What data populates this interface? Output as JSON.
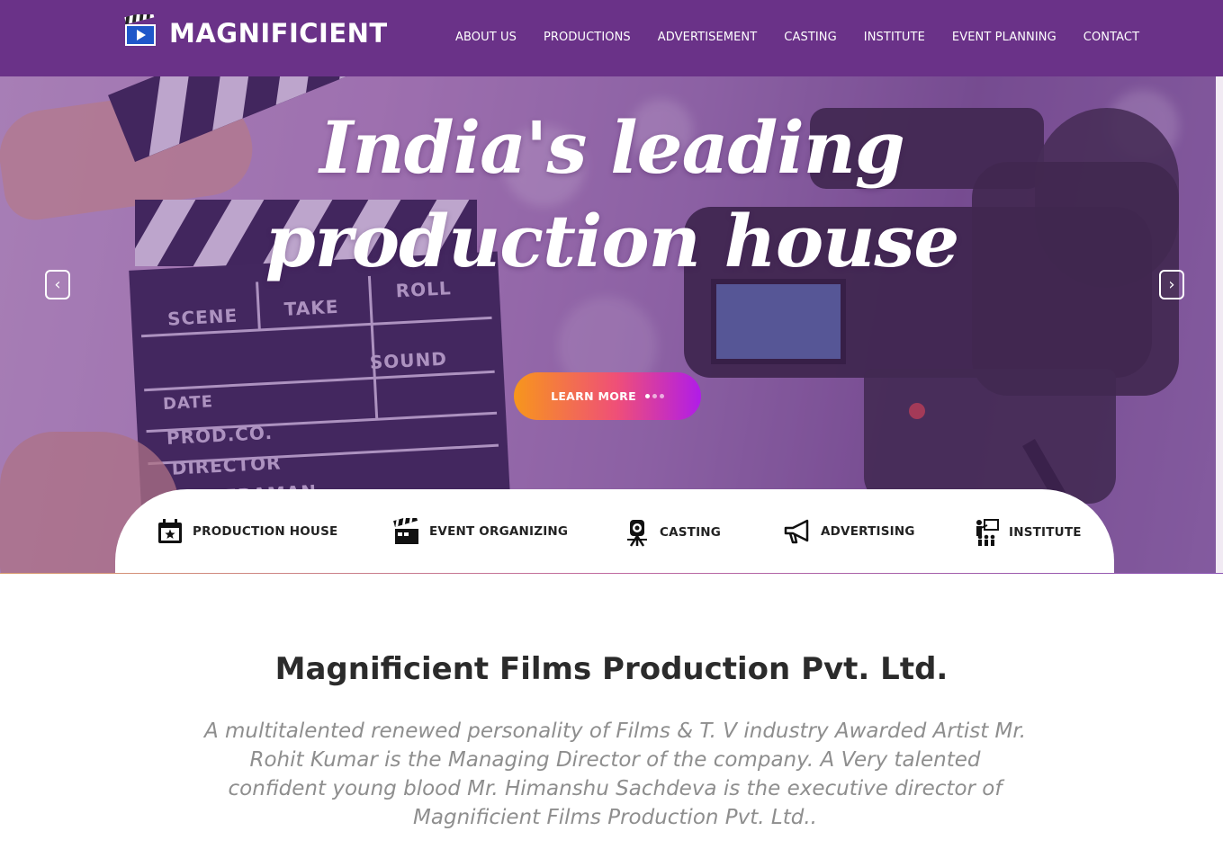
{
  "brand": {
    "name": "MAGNIFICIENT",
    "logo_icon": "clapperboard-play-icon"
  },
  "nav": {
    "items": [
      {
        "label": "ABOUT US"
      },
      {
        "label": "PRODUCTIONS"
      },
      {
        "label": "ADVERTISEMENT"
      },
      {
        "label": "CASTING"
      },
      {
        "label": "INSTITUTE"
      },
      {
        "label": "EVENT PLANNING"
      },
      {
        "label": "CONTACT"
      }
    ]
  },
  "hero": {
    "headline_line1": "India's leading",
    "headline_line2": "production house",
    "prev_icon": "chevron-left-icon",
    "next_icon": "chevron-right-icon",
    "cta_label": "LEARN MORE",
    "clapper_labels": {
      "scene": "SCENE",
      "take": "TAKE",
      "roll": "ROLL",
      "sound": "SOUND",
      "date": "DATE",
      "prod": "PROD.CO.",
      "director": "DIRECTOR",
      "cameraman": "CAMERAMAN"
    }
  },
  "services": [
    {
      "label": "PRODUCTION HOUSE",
      "icon": "calendar-star-icon"
    },
    {
      "label": "EVENT ORGANIZING",
      "icon": "clapperboard-icon"
    },
    {
      "label": "CASTING",
      "icon": "camera-tripod-icon"
    },
    {
      "label": "ADVERTISING",
      "icon": "megaphone-icon"
    },
    {
      "label": "INSTITUTE",
      "icon": "classroom-icon"
    }
  ],
  "about": {
    "title": "Magnificient Films Production Pvt. Ltd.",
    "text": "A multitalented renewed personality of Films & T. V industry Awarded Artist Mr. Rohit Kumar is the Managing Director of the company. A Very talented confident young blood Mr. Himanshu Sachdeva is the executive director of Magnificient Films Production Pvt. Ltd.."
  },
  "colors": {
    "navbar": "#6a3288",
    "cta_gradient_start": "#f7961c",
    "cta_gradient_end": "#b01ce8",
    "title_text": "#2b2b2b",
    "body_text": "#8e8e8e"
  }
}
